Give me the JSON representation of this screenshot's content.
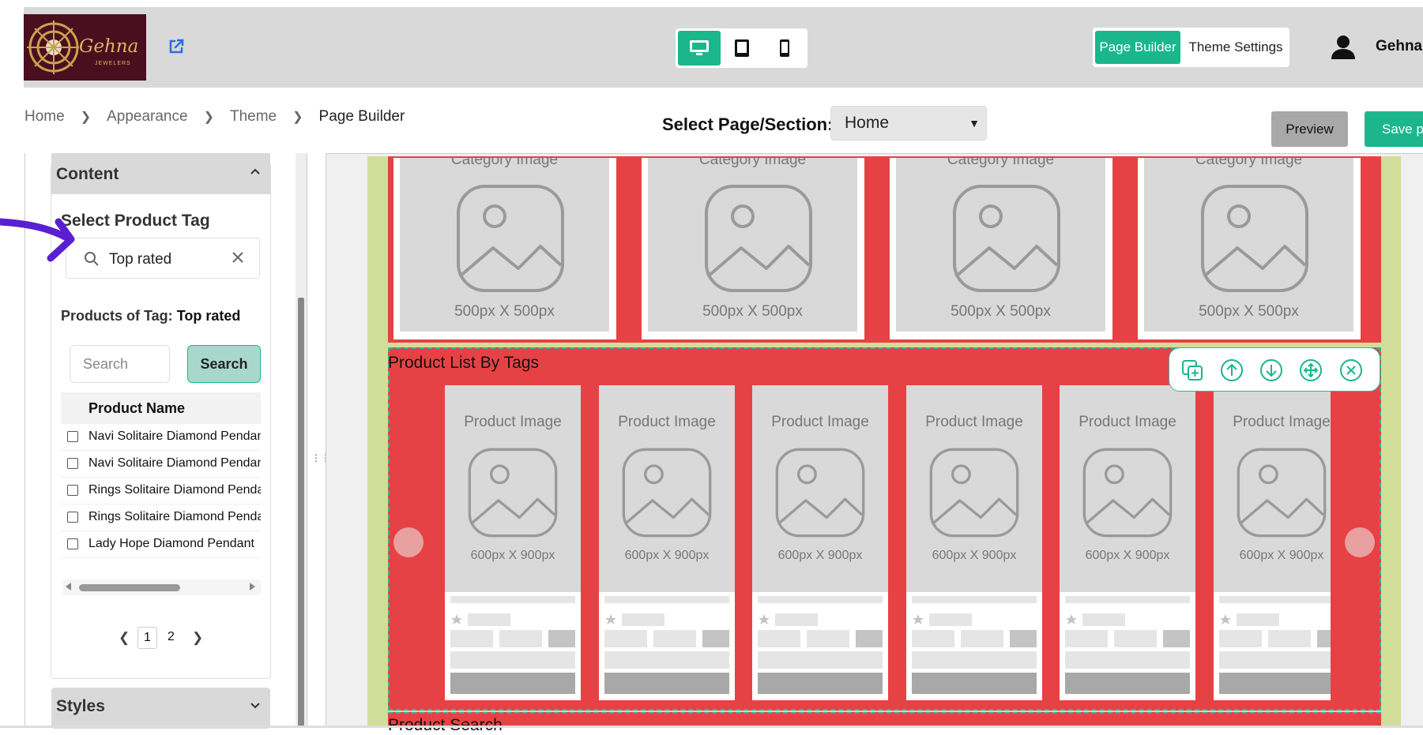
{
  "header": {
    "brand": "Gehna",
    "brand_sub": "JEWELERS",
    "devices": [
      "desktop-icon",
      "tablet-icon",
      "mobile-icon"
    ],
    "active_device": "desktop",
    "page_builder_label": "Page Builder",
    "theme_settings_label": "Theme Settings",
    "username": "Gehna",
    "accent": "#1bb68c"
  },
  "breadcrumb": [
    "Home",
    "Appearance",
    "Theme",
    "Page Builder"
  ],
  "page_select": {
    "label": "Select Page/Section:",
    "value": "Home"
  },
  "actions": {
    "preview": "Preview",
    "save": "Save pa"
  },
  "left_panel": {
    "content_title": "Content",
    "tag_label": "Select Product Tag",
    "tag_value": "Top rated",
    "products_of_tag_label": "Products of Tag:",
    "products_of_tag_value": "Top rated",
    "search_placeholder": "Search",
    "search_button": "Search",
    "table_header": "Product Name",
    "products": [
      "Navi Solitaire Diamond Pendant",
      "Navi Solitaire Diamond Pendant",
      "Rings Solitaire Diamond Pendant",
      "Rings Solitaire Diamond Pendant",
      "Lady Hope Diamond Pendant"
    ],
    "pagination": [
      "1",
      "2"
    ],
    "current_page": "1",
    "styles_title": "Styles"
  },
  "canvas": {
    "category_label": "Category Image",
    "category_dim": "500px X 500px",
    "category_count": 4,
    "section_title": "Product List By Tags",
    "product_label": "Product Image",
    "product_dim": "600px X 900px",
    "product_count": 6,
    "next_section_title": "Product Search",
    "section_color": "#e64245",
    "toolbar_icons": [
      "duplicate-icon",
      "move-up-icon",
      "move-down-icon",
      "drag-move-icon",
      "remove-icon"
    ]
  }
}
